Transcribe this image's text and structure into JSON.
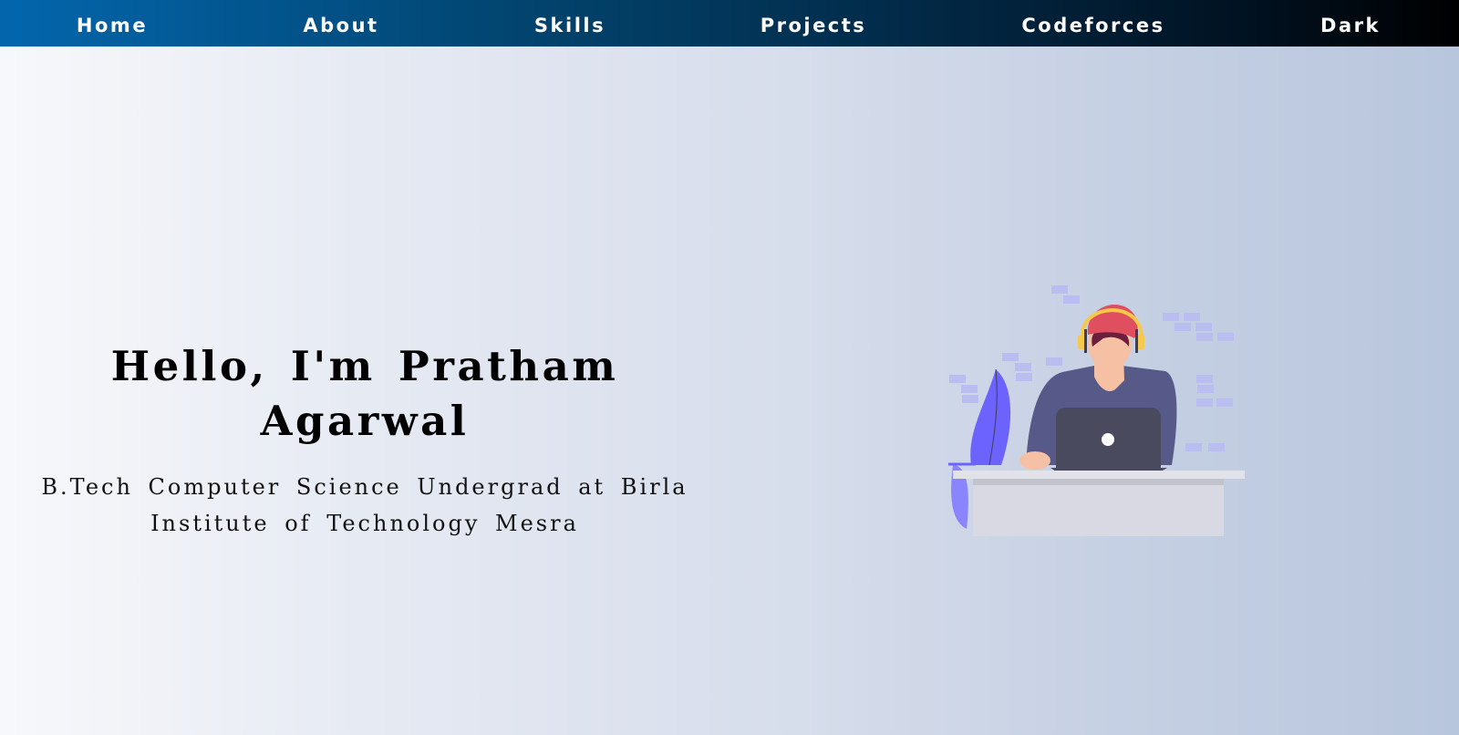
{
  "nav": {
    "home": "Home",
    "about": "About",
    "skills": "Skills",
    "projects": "Projects",
    "codeforces": "Codeforces",
    "theme_toggle": "Dark"
  },
  "hero": {
    "title": "Hello, I'm Pratham Agarwal",
    "subtitle": "B.Tech Computer Science Undergrad at Birla Institute of Technology Mesra"
  },
  "colors": {
    "nav_gradient_start": "#0366ad",
    "nav_gradient_end": "#000000",
    "nav_text": "#ffffff",
    "heading_text": "#000000",
    "plant": "#6c63ff",
    "shirt": "#575a89",
    "laptop": "#3f3d56",
    "cap": "#e04f5f",
    "headphones": "#f7c948",
    "desk": "#d9d9e3"
  },
  "illustration": {
    "icon": "developer-at-laptop-illustration"
  }
}
